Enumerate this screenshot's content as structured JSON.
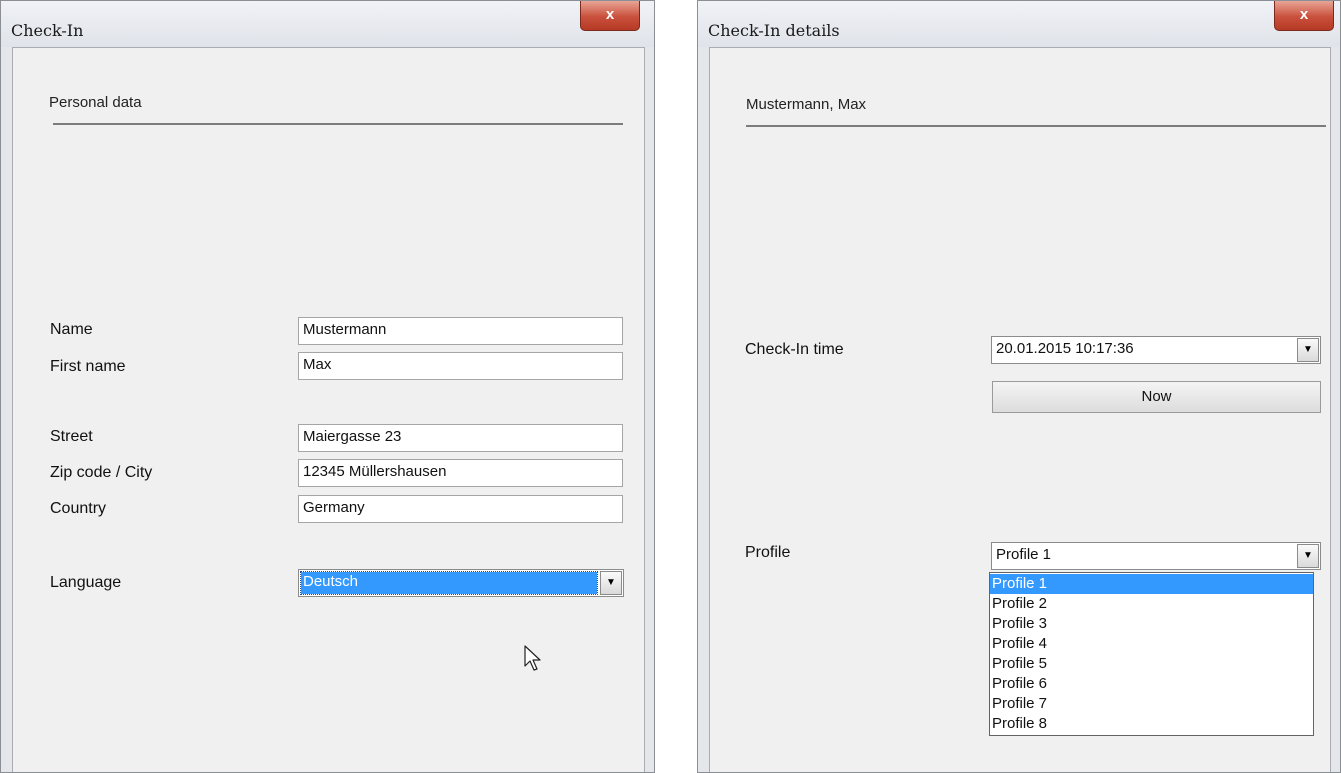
{
  "left_window": {
    "title": "Check-In",
    "close_glyph": "x",
    "section_title": "Personal data",
    "fields": [
      {
        "label": "Name",
        "value": "Mustermann"
      },
      {
        "label": "First name",
        "value": "Max"
      },
      {
        "label": "Street",
        "value": "Maiergasse 23"
      },
      {
        "label": "Zip code / City",
        "value": "12345 Müllershausen"
      },
      {
        "label": "Country",
        "value": "Germany"
      }
    ],
    "language": {
      "label": "Language",
      "value": "Deutsch",
      "arrow_glyph": "▼"
    }
  },
  "right_window": {
    "title": "Check-In details",
    "close_glyph": "x",
    "section_title": "Mustermann, Max",
    "checkin_time": {
      "label": "Check-In time",
      "value": "20.01.2015 10:17:36",
      "arrow_glyph": "▼"
    },
    "now_button_label": "Now",
    "profile": {
      "label": "Profile",
      "value": "Profile 1",
      "arrow_glyph": "▼",
      "options": [
        "Profile 1",
        "Profile 2",
        "Profile 3",
        "Profile 4",
        "Profile 5",
        "Profile 6",
        "Profile 7",
        "Profile 8"
      ],
      "highlighted_option": "Profile 1"
    }
  },
  "colors": {
    "selection": "#3399ff",
    "close_button": "#c9503c",
    "window_background": "#f0f0f0"
  }
}
